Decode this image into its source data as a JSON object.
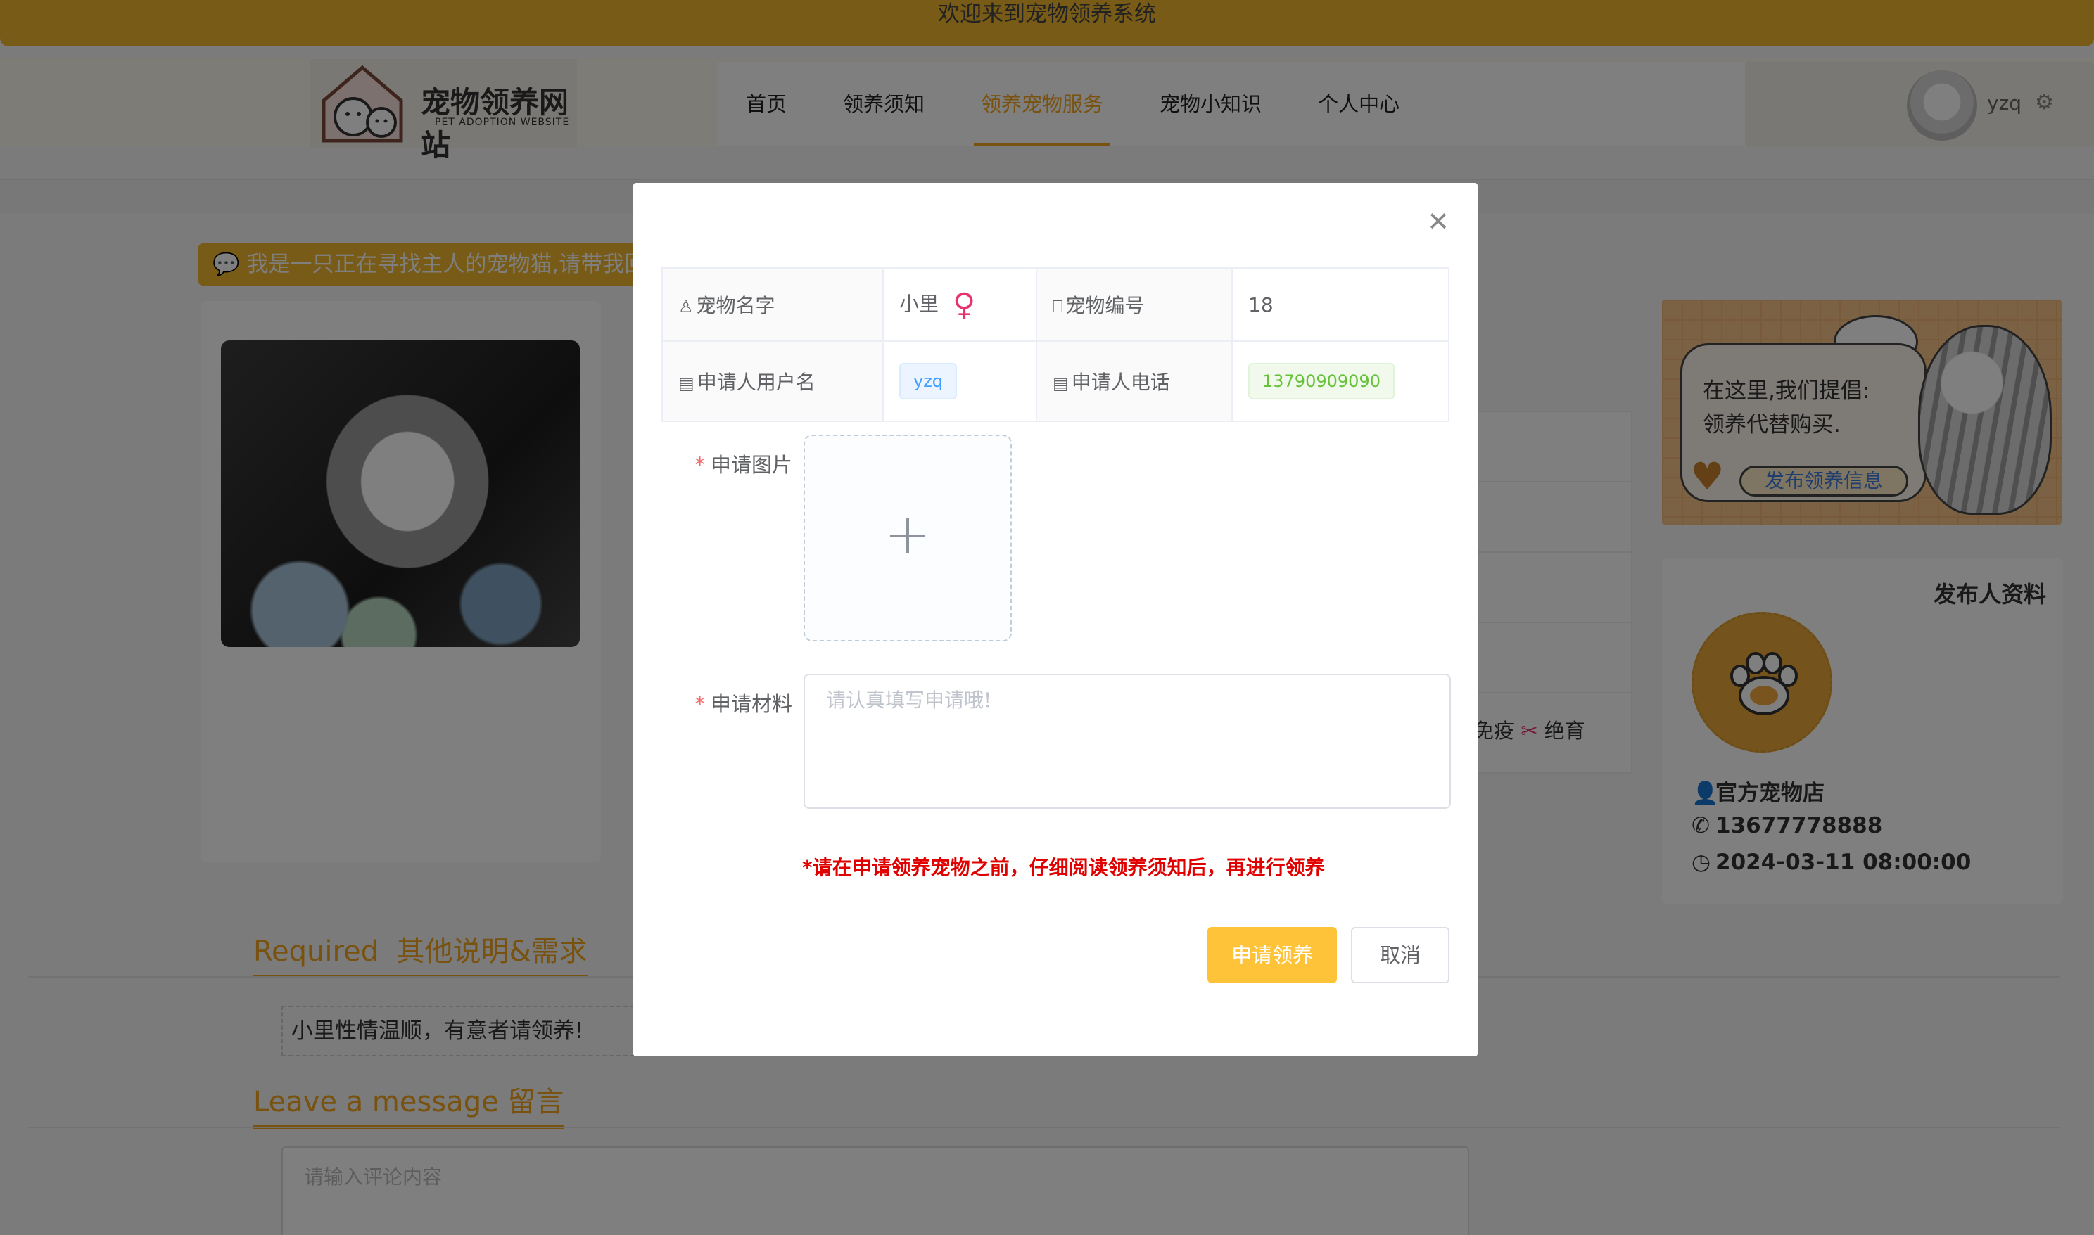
{
  "topbar": {
    "welcome": "欢迎来到宠物领养系统"
  },
  "logo": {
    "title": "宠物领养网站",
    "subtitle": "PET ADOPTION WEBSITE"
  },
  "nav": {
    "items": [
      {
        "label": "首页",
        "active": false
      },
      {
        "label": "领养须知",
        "active": false
      },
      {
        "label": "领养宠物服务",
        "active": true
      },
      {
        "label": "宠物小知识",
        "active": false
      },
      {
        "label": "个人中心",
        "active": false
      }
    ]
  },
  "user": {
    "name": "yzq"
  },
  "notice": {
    "text": "我是一只正在寻找主人的宠物猫,请带我回家"
  },
  "mid": {
    "partial_text": "免疫",
    "neutered": "绝育"
  },
  "promo": {
    "line1": "在这里,我们提倡:",
    "line2": "领养代替购买.",
    "button": "发布领养信息"
  },
  "publisher": {
    "title": "发布人资料",
    "name": "官方宠物店",
    "phone": "13677778888",
    "time": "2024-03-11 08:00:00"
  },
  "sections": {
    "required_en": "Required",
    "required_cn": "其他说明&需求",
    "description": "小里性情温顺，有意者请领养!",
    "message_en": "Leave a message",
    "message_cn": "留言",
    "comment_placeholder": "请输入评论内容"
  },
  "modal": {
    "pet_name_label": "宠物名字",
    "pet_name": "小里",
    "gender_symbol": "♀",
    "pet_id_label": "宠物编号",
    "pet_id": "18",
    "applicant_label": "申请人用户名",
    "applicant": "yzq",
    "phone_label": "申请人电话",
    "phone": "13790909090",
    "image_label": "申请图片",
    "material_label": "申请材料",
    "material_placeholder": "请认真填写申请哦!",
    "warning": "*请在申请领养宠物之前，仔细阅读领养须知后，再进行领养",
    "apply_button": "申请领养",
    "cancel_button": "取消"
  },
  "colors": {
    "accent": "#f1b72e",
    "nav_active": "#f0a51c",
    "apply": "#ffc33a",
    "warning": "#e00000"
  }
}
